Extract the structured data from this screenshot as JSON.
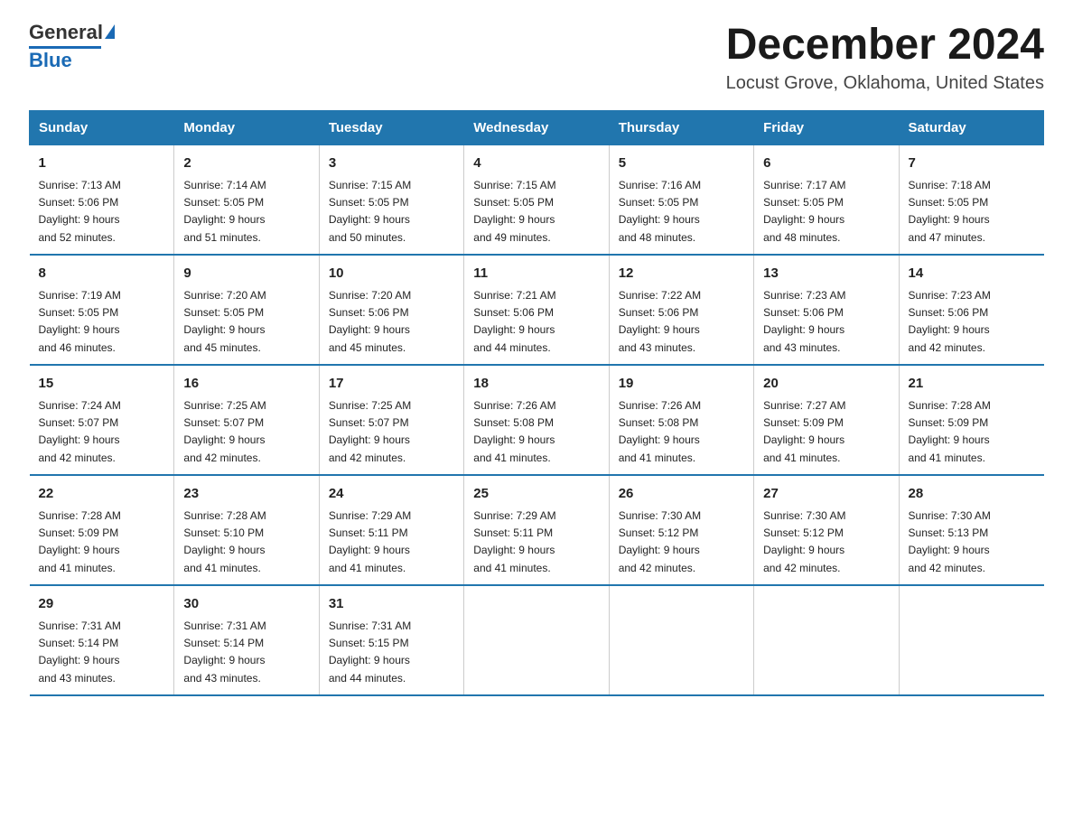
{
  "header": {
    "logo_text_general": "General",
    "logo_text_blue": "Blue",
    "month_title": "December 2024",
    "location": "Locust Grove, Oklahoma, United States"
  },
  "days_of_week": [
    "Sunday",
    "Monday",
    "Tuesday",
    "Wednesday",
    "Thursday",
    "Friday",
    "Saturday"
  ],
  "weeks": [
    [
      {
        "day": "1",
        "sunrise": "7:13 AM",
        "sunset": "5:06 PM",
        "daylight": "9 hours and 52 minutes."
      },
      {
        "day": "2",
        "sunrise": "7:14 AM",
        "sunset": "5:05 PM",
        "daylight": "9 hours and 51 minutes."
      },
      {
        "day": "3",
        "sunrise": "7:15 AM",
        "sunset": "5:05 PM",
        "daylight": "9 hours and 50 minutes."
      },
      {
        "day": "4",
        "sunrise": "7:15 AM",
        "sunset": "5:05 PM",
        "daylight": "9 hours and 49 minutes."
      },
      {
        "day": "5",
        "sunrise": "7:16 AM",
        "sunset": "5:05 PM",
        "daylight": "9 hours and 48 minutes."
      },
      {
        "day": "6",
        "sunrise": "7:17 AM",
        "sunset": "5:05 PM",
        "daylight": "9 hours and 48 minutes."
      },
      {
        "day": "7",
        "sunrise": "7:18 AM",
        "sunset": "5:05 PM",
        "daylight": "9 hours and 47 minutes."
      }
    ],
    [
      {
        "day": "8",
        "sunrise": "7:19 AM",
        "sunset": "5:05 PM",
        "daylight": "9 hours and 46 minutes."
      },
      {
        "day": "9",
        "sunrise": "7:20 AM",
        "sunset": "5:05 PM",
        "daylight": "9 hours and 45 minutes."
      },
      {
        "day": "10",
        "sunrise": "7:20 AM",
        "sunset": "5:06 PM",
        "daylight": "9 hours and 45 minutes."
      },
      {
        "day": "11",
        "sunrise": "7:21 AM",
        "sunset": "5:06 PM",
        "daylight": "9 hours and 44 minutes."
      },
      {
        "day": "12",
        "sunrise": "7:22 AM",
        "sunset": "5:06 PM",
        "daylight": "9 hours and 43 minutes."
      },
      {
        "day": "13",
        "sunrise": "7:23 AM",
        "sunset": "5:06 PM",
        "daylight": "9 hours and 43 minutes."
      },
      {
        "day": "14",
        "sunrise": "7:23 AM",
        "sunset": "5:06 PM",
        "daylight": "9 hours and 42 minutes."
      }
    ],
    [
      {
        "day": "15",
        "sunrise": "7:24 AM",
        "sunset": "5:07 PM",
        "daylight": "9 hours and 42 minutes."
      },
      {
        "day": "16",
        "sunrise": "7:25 AM",
        "sunset": "5:07 PM",
        "daylight": "9 hours and 42 minutes."
      },
      {
        "day": "17",
        "sunrise": "7:25 AM",
        "sunset": "5:07 PM",
        "daylight": "9 hours and 42 minutes."
      },
      {
        "day": "18",
        "sunrise": "7:26 AM",
        "sunset": "5:08 PM",
        "daylight": "9 hours and 41 minutes."
      },
      {
        "day": "19",
        "sunrise": "7:26 AM",
        "sunset": "5:08 PM",
        "daylight": "9 hours and 41 minutes."
      },
      {
        "day": "20",
        "sunrise": "7:27 AM",
        "sunset": "5:09 PM",
        "daylight": "9 hours and 41 minutes."
      },
      {
        "day": "21",
        "sunrise": "7:28 AM",
        "sunset": "5:09 PM",
        "daylight": "9 hours and 41 minutes."
      }
    ],
    [
      {
        "day": "22",
        "sunrise": "7:28 AM",
        "sunset": "5:09 PM",
        "daylight": "9 hours and 41 minutes."
      },
      {
        "day": "23",
        "sunrise": "7:28 AM",
        "sunset": "5:10 PM",
        "daylight": "9 hours and 41 minutes."
      },
      {
        "day": "24",
        "sunrise": "7:29 AM",
        "sunset": "5:11 PM",
        "daylight": "9 hours and 41 minutes."
      },
      {
        "day": "25",
        "sunrise": "7:29 AM",
        "sunset": "5:11 PM",
        "daylight": "9 hours and 41 minutes."
      },
      {
        "day": "26",
        "sunrise": "7:30 AM",
        "sunset": "5:12 PM",
        "daylight": "9 hours and 42 minutes."
      },
      {
        "day": "27",
        "sunrise": "7:30 AM",
        "sunset": "5:12 PM",
        "daylight": "9 hours and 42 minutes."
      },
      {
        "day": "28",
        "sunrise": "7:30 AM",
        "sunset": "5:13 PM",
        "daylight": "9 hours and 42 minutes."
      }
    ],
    [
      {
        "day": "29",
        "sunrise": "7:31 AM",
        "sunset": "5:14 PM",
        "daylight": "9 hours and 43 minutes."
      },
      {
        "day": "30",
        "sunrise": "7:31 AM",
        "sunset": "5:14 PM",
        "daylight": "9 hours and 43 minutes."
      },
      {
        "day": "31",
        "sunrise": "7:31 AM",
        "sunset": "5:15 PM",
        "daylight": "9 hours and 44 minutes."
      },
      null,
      null,
      null,
      null
    ]
  ],
  "labels": {
    "sunrise": "Sunrise:",
    "sunset": "Sunset:",
    "daylight": "Daylight:"
  }
}
